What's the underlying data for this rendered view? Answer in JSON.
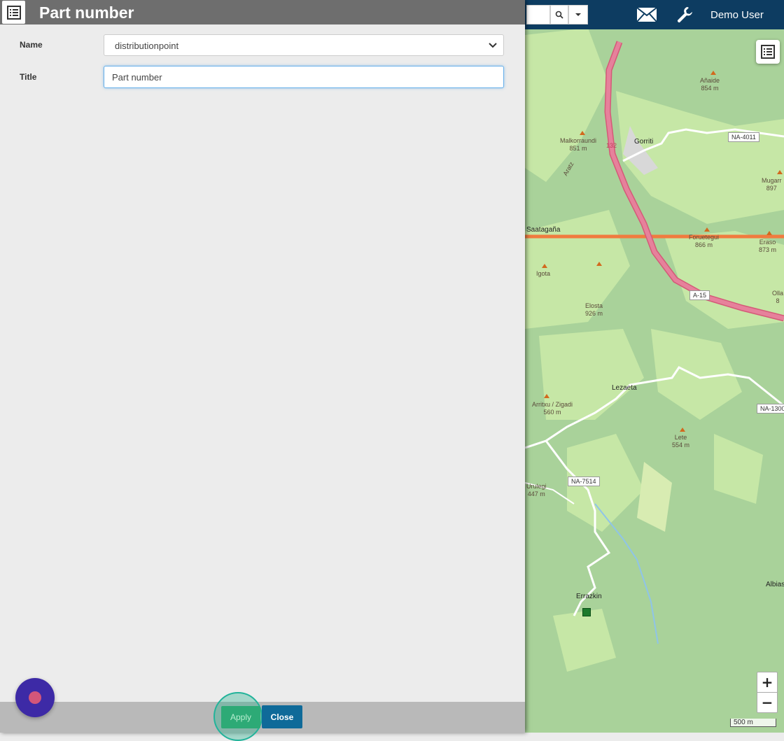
{
  "panel": {
    "title": "Part number",
    "name_label": "Name",
    "name_value": "distributionpoint",
    "title_label": "Title",
    "title_value": "Part number",
    "apply_label": "Apply",
    "close_label": "Close"
  },
  "topbar": {
    "user": "Demo User"
  },
  "map": {
    "scale": "500 m",
    "zoom_in": "+",
    "zoom_out": "−",
    "peaks": [
      {
        "name": "Añaide",
        "elev": "854 m"
      },
      {
        "name": "Malkorraundi",
        "elev": "851 m"
      },
      {
        "name": "Mugarr",
        "elev": "897"
      },
      {
        "name": "Aratz"
      },
      {
        "name": "Foruetegui",
        "elev": "866 m"
      },
      {
        "name": "Eraso",
        "elev": "873 m"
      },
      {
        "name": "Igota"
      },
      {
        "name": "Elosta",
        "elev": "926 m"
      },
      {
        "name": "Olla",
        "elev": "8"
      },
      {
        "name": "Arritxu / Zigadi",
        "elev": "560 m"
      },
      {
        "name": "Lete",
        "elev": "554 m"
      },
      {
        "name": "Urulegi",
        "elev": "447 m"
      }
    ],
    "towns": [
      "Gorriti",
      "Lezaeta",
      "Errazkin",
      "Albias",
      "Saatagaña"
    ],
    "roads": [
      "NA-4011",
      "A-15",
      "NA-1300",
      "NA-7514",
      "132"
    ]
  }
}
